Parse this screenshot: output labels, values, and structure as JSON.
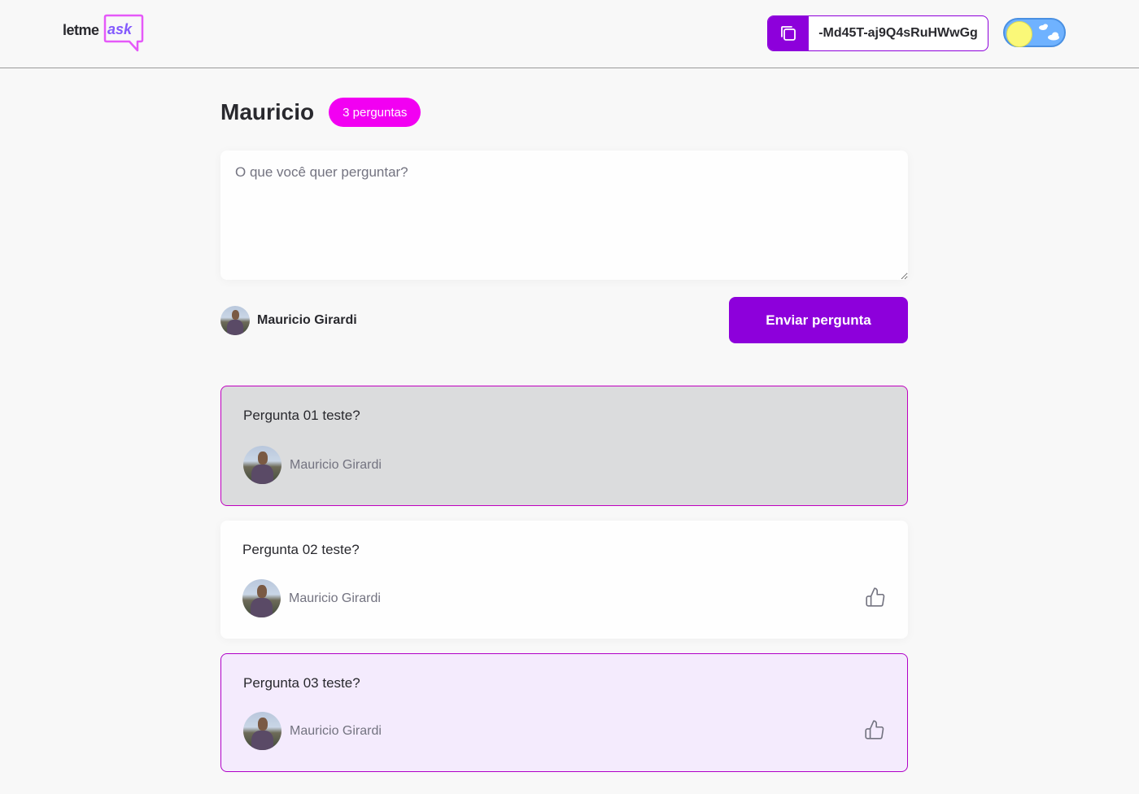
{
  "header": {
    "logo_letme": "letme",
    "logo_ask": "ask",
    "room_code": "-Md45T-aj9Q4sRuHWwGg"
  },
  "room": {
    "title": "Mauricio",
    "question_count": "3 perguntas"
  },
  "form": {
    "placeholder": "O que você quer perguntar?",
    "user_name": "Mauricio Girardi",
    "submit_label": "Enviar pergunta"
  },
  "questions": [
    {
      "content": "Pergunta 01 teste?",
      "author": "Mauricio Girardi",
      "state": "answered"
    },
    {
      "content": "Pergunta 02 teste?",
      "author": "Mauricio Girardi",
      "state": "normal"
    },
    {
      "content": "Pergunta 03 teste?",
      "author": "Mauricio Girardi",
      "state": "highlighted"
    }
  ],
  "colors": {
    "brand_purple": "#8d00db",
    "badge_magenta": "#f200f2",
    "answered_bg": "#dbdcdd",
    "highlighted_bg": "#f4ebfd"
  },
  "icons": {
    "copy": "copy-icon",
    "like": "thumbs-up-icon",
    "theme": "sun-icon"
  }
}
